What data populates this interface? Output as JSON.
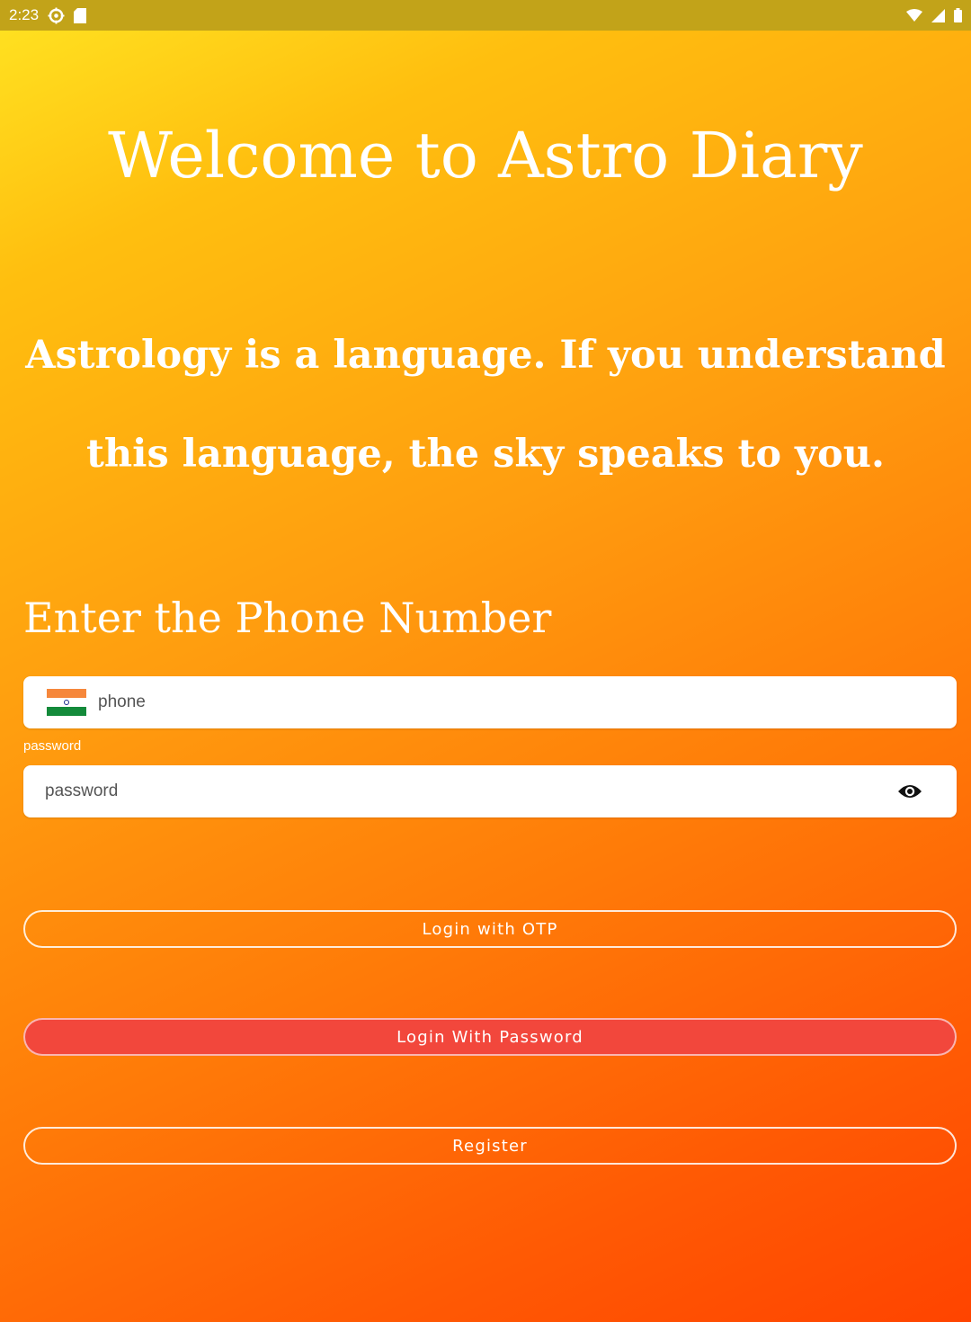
{
  "status_bar": {
    "time": "2:23",
    "left_icons": [
      "settings-icon",
      "sd-card-icon"
    ],
    "right_icons": [
      "wifi-icon",
      "signal-icon",
      "battery-icon"
    ]
  },
  "welcome_title": "Welcome to Astro Diary",
  "quote": "Astrology is a language. If you understand this language, the sky speaks to you.",
  "phone_heading": "Enter the Phone Number",
  "phone_field": {
    "country_flag": "india-flag-icon",
    "placeholder": "phone",
    "value": ""
  },
  "password_field": {
    "label": "password",
    "placeholder": "password",
    "value": "",
    "toggle_icon": "eye-icon"
  },
  "buttons": {
    "login_otp": "Login with OTP",
    "login_password": "Login With Password",
    "register": "Register"
  },
  "colors": {
    "status_bar": "#c2a319",
    "gradient_start": "#ffe422",
    "gradient_end": "#ff4400",
    "password_button": "#f2473c"
  }
}
